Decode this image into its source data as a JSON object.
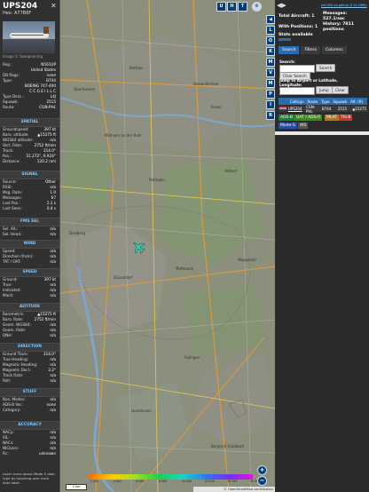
{
  "left_panel": {
    "callsign": "UPS204",
    "hex_line": "Hex: A77B6F",
    "close": "✕",
    "photo_caption": "Image © Saxophoning",
    "identity": [
      {
        "k": "Reg.:",
        "v": "N561UP"
      },
      {
        "k": "",
        "v": "United States"
      },
      {
        "k": "DB flags:",
        "v": "none"
      },
      {
        "k": "Type:",
        "v": "B744"
      },
      {
        "k": "",
        "v": "BOEING 747-400"
      },
      {
        "k": "",
        "v": "C C G E I L L C"
      },
      {
        "k": "Type Desc.:",
        "v": "L4J"
      },
      {
        "k": "Squawk:",
        "v": "2515"
      },
      {
        "k": "Route:",
        "v": "CGN-PHL"
      }
    ],
    "spatial_title": "SPATIAL",
    "spatial": [
      {
        "k": "Groundspeed:",
        "v": "397 kt"
      },
      {
        "k": "Baro. altitude:",
        "v": "▲15275 ft"
      },
      {
        "k": "WGS84 altitude:",
        "v": "n/a"
      },
      {
        "k": "Vert. Rate:",
        "v": "2752 ft/min"
      },
      {
        "k": "Track:",
        "v": "314.0°"
      },
      {
        "k": "Pos.:",
        "v": "51.272°, 6.924°"
      },
      {
        "k": "Distance:",
        "v": "120.2 nmi"
      }
    ],
    "signal_title": "SIGNAL",
    "signal": [
      {
        "k": "Source:",
        "v": "Other"
      },
      {
        "k": "RSSI:",
        "v": "n/a"
      },
      {
        "k": "Msg. Rate:",
        "v": "1.0"
      },
      {
        "k": "Messages:",
        "v": "67"
      },
      {
        "k": "Last Pos.:",
        "v": "2.1 s"
      },
      {
        "k": "Last Seen:",
        "v": "0.4 s"
      }
    ],
    "fms_title": "FMS SEL",
    "fms": [
      {
        "k": "Sel. Alt.:",
        "v": "n/a"
      },
      {
        "k": "Sel. Head.:",
        "v": "n/a"
      }
    ],
    "wind_title": "WIND",
    "wind": [
      {
        "k": "Speed:",
        "v": "n/a"
      },
      {
        "k": "Direction (from):",
        "v": "n/a"
      },
      {
        "k": "TAT / OAT:",
        "v": "n/a"
      }
    ],
    "speed_title": "SPEED",
    "speed": [
      {
        "k": "Ground:",
        "v": "397 kt"
      },
      {
        "k": "True:",
        "v": "n/a"
      },
      {
        "k": "Indicated:",
        "v": "n/a"
      },
      {
        "k": "Mach:",
        "v": "n/a"
      }
    ],
    "altitude_title": "ALTITUDE",
    "altitude": [
      {
        "k": "Barometric:",
        "v": "▲15275 ft"
      },
      {
        "k": "Baro. Rate:",
        "v": "2752 ft/min"
      },
      {
        "k": "Geom. WGS84:",
        "v": "n/a"
      },
      {
        "k": "Geom. Rate:",
        "v": "n/a"
      },
      {
        "k": "QNH:",
        "v": "n/a"
      }
    ],
    "direction_title": "DIRECTION",
    "direction": [
      {
        "k": "Ground Track:",
        "v": "314.0°"
      },
      {
        "k": "True Heading:",
        "v": "n/a"
      },
      {
        "k": "Magnetic Heading:",
        "v": "n/a"
      },
      {
        "k": "Magnetic Decl.:",
        "v": "3.2°"
      },
      {
        "k": "Track Rate:",
        "v": "n/a"
      },
      {
        "k": "Roll:",
        "v": "n/a"
      }
    ],
    "stuff_title": "STUFF",
    "stuff": [
      {
        "k": "Nav. Modes:",
        "v": "n/a"
      },
      {
        "k": "ADS-B Ver.:",
        "v": "none"
      },
      {
        "k": "Category:",
        "v": "n/a"
      }
    ],
    "accuracy_title": "ACCURACY",
    "accuracy": [
      {
        "k": "NACp:",
        "v": "n/a"
      },
      {
        "k": "SIL:",
        "v": "n/a"
      },
      {
        "k": "NACv:",
        "v": "n/a"
      },
      {
        "k": "NICbaro:",
        "v": "n/a"
      },
      {
        "k": "Rc:",
        "v": "unknown"
      }
    ],
    "learn_more": "Learn more about Mode S data type by hovering over each data label."
  },
  "map": {
    "top_buttons": [
      "U",
      "H",
      "T"
    ],
    "side_buttons": [
      "◀",
      "L",
      "O",
      "K",
      "M",
      "V",
      "M",
      "P",
      "I",
      "R"
    ],
    "place_labels": [
      "Bottrop",
      "Oberhausen",
      "Gelsenkirchen",
      "Essen",
      "Mülheim an der Ruhr",
      "Duisburg",
      "Ratingen",
      "Velbert",
      "Düsseldorf",
      "Wuppertal",
      "Mettmann",
      "Solingen",
      "Leverkusen",
      "Bergisch Gladbach"
    ],
    "scale_label": "2 km",
    "legend_ticks": [
      "2 000",
      "4 000",
      "6 000",
      "8 000",
      "10 000",
      "20 000",
      "30 000",
      "40 000+"
    ],
    "attribution": "© OpenStreetMap contributors",
    "zoom_in": "+",
    "zoom_out": "−",
    "aircraft_track_deg": 314.0
  },
  "right_panel": {
    "version_line": "tar1090 on github (3.14.1689)",
    "total_aircraft": "Total Aircraft: 1",
    "messages": "Messages: 527.1/sec",
    "with_positions": "With Positions: 1",
    "history": "History: 7811 positions",
    "stats_available": "Stats available",
    "tabs": [
      "Search",
      "Filters",
      "Columns"
    ],
    "search_label": "Search:",
    "search_button": "Search",
    "clear_search_button": "Clear Search",
    "jump_label": "Jump to Airport or Latitude, Longitude:",
    "jump_button": "Jump",
    "clear_button": "Clear",
    "table_headers": [
      "",
      "Callsign",
      "Route",
      "Type",
      "Squawk",
      "Alt. (ft)"
    ],
    "table_row": {
      "callsign": "UPS204",
      "route": "CGN-PHL",
      "type": "B744",
      "squawk": "2515",
      "alt": "▲15275"
    },
    "badges": [
      {
        "label": "ADS-B",
        "color": "#1a7f3c"
      },
      {
        "label": "UAT / ADS-R",
        "color": "#3a8a1a"
      },
      {
        "label": "MLAT",
        "color": "#b07a12"
      },
      {
        "label": "TIS-B",
        "color": "#c0392b"
      },
      {
        "label": "Mode-S",
        "color": "#2a4fa0"
      },
      {
        "label": "AIS",
        "color": "#555555"
      }
    ]
  }
}
